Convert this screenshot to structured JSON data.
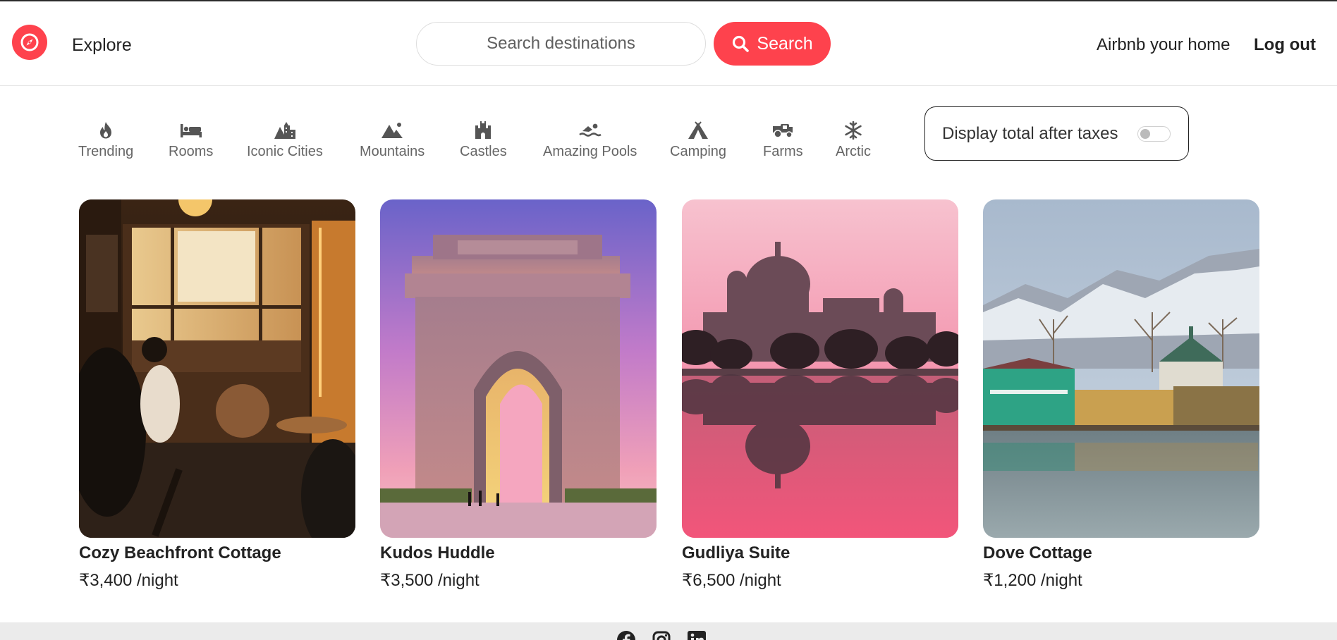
{
  "header": {
    "logo_icon": "compass-icon",
    "explore_label": "Explore",
    "search_placeholder": "Search destinations",
    "search_button_label": "Search",
    "host_link": "Airbnb your home",
    "logout_link": "Log out"
  },
  "filters": [
    {
      "label": "Trending",
      "icon": "fire-icon"
    },
    {
      "label": "Rooms",
      "icon": "bed-icon"
    },
    {
      "label": "Iconic Cities",
      "icon": "city-icon"
    },
    {
      "label": "Mountains",
      "icon": "mountain-icon"
    },
    {
      "label": "Castles",
      "icon": "castle-icon"
    },
    {
      "label": "Amazing Pools",
      "icon": "swimmer-icon"
    },
    {
      "label": "Camping",
      "icon": "tent-icon"
    },
    {
      "label": "Farms",
      "icon": "tractor-icon"
    },
    {
      "label": "Arctic",
      "icon": "snowflake-icon"
    }
  ],
  "tax_toggle": {
    "label": "Display total after taxes",
    "enabled": false
  },
  "listings": [
    {
      "title": "Cozy Beachfront Cottage",
      "price": "₹3,400 /night"
    },
    {
      "title": "Kudos Huddle",
      "price": "₹3,500 /night"
    },
    {
      "title": "Gudliya Suite",
      "price": "₹6,500 /night"
    },
    {
      "title": "Dove Cottage",
      "price": "₹1,200 /night"
    }
  ],
  "footer": {
    "social_icons": [
      "facebook-icon",
      "instagram-icon",
      "linkedin-icon"
    ]
  },
  "colors": {
    "brand": "#fe424d",
    "text": "#222222",
    "muted": "#666666",
    "footer_bg": "#ebebeb"
  }
}
